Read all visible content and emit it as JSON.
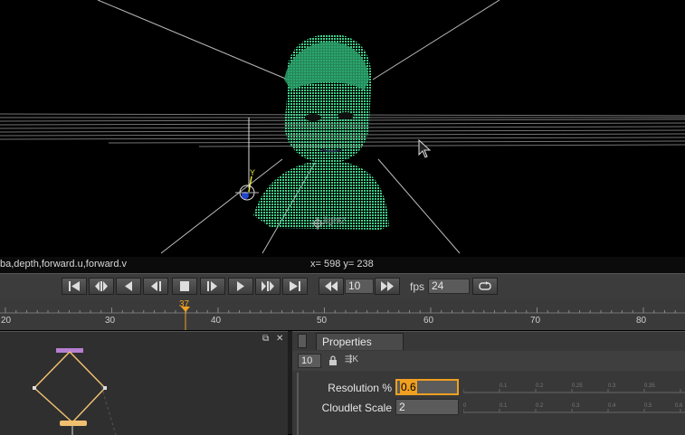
{
  "viewer": {
    "light_label": "light2",
    "axis_label": "Y",
    "channels": "ba,depth,forward.u,forward.v",
    "coords": "x= 598 y= 238"
  },
  "transport": {
    "step_value": "10",
    "fps_label": "fps",
    "fps_value": "24"
  },
  "timeline": {
    "ticks": [
      "20",
      "30",
      "40",
      "50",
      "60",
      "70",
      "80"
    ],
    "current_frame": "37"
  },
  "graph_panel": {
    "float_label": "⧉",
    "close_label": "✕"
  },
  "properties": {
    "tab_label": "Properties",
    "frame_field": "10",
    "ext_label": "⇶K",
    "rows": [
      {
        "label": "Resolution %",
        "value": "0.6",
        "slider_ticks": [
          "0",
          "0.05",
          "0.1",
          "0.15",
          "0.2",
          "0.25",
          "0.3",
          "0.35",
          "0.4",
          "0.45"
        ]
      },
      {
        "label": "Cloudlet Scale",
        "value": "2",
        "slider_ticks": [
          "0",
          "0.1",
          "0.2",
          "0.3",
          "0.4",
          "0.5",
          "0.6"
        ]
      }
    ]
  },
  "colors": {
    "accent": "#f0a020",
    "pointcloud": "#3fd08a",
    "panel_bg": "#383838"
  },
  "icons": [
    "first-frame-icon",
    "prev-keyframe-icon",
    "play-reverse-icon",
    "step-back-icon",
    "stop-icon",
    "step-forward-icon",
    "play-icon",
    "next-keyframe-icon",
    "last-frame-icon",
    "skip-back-icon",
    "skip-forward-icon",
    "loop-icon",
    "lock-icon"
  ]
}
